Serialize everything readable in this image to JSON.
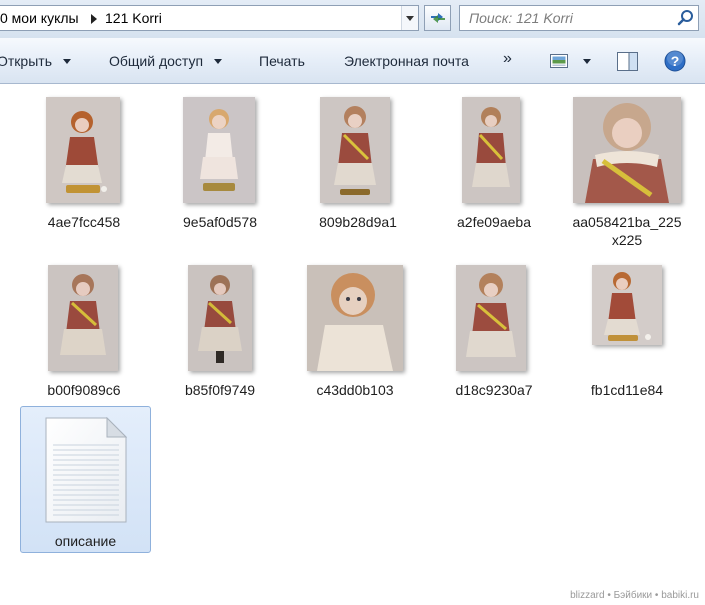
{
  "address": {
    "segments": [
      "0 мои куклы",
      "121 Korri"
    ]
  },
  "search": {
    "placeholder": "Поиск: 121 Korri"
  },
  "toolbar": {
    "open_label": "Открыть",
    "share_label": "Общий доступ",
    "print_label": "Печать",
    "email_label": "Электронная почта",
    "more_label": "»"
  },
  "files": [
    {
      "name": "4ae7fcc458",
      "type": "image"
    },
    {
      "name": "9e5af0d578",
      "type": "image"
    },
    {
      "name": "809b28d9a1",
      "type": "image"
    },
    {
      "name": "a2fe09aeba",
      "type": "image"
    },
    {
      "name_line1": "aa058421ba_225",
      "name_line2": "x225",
      "type": "image"
    },
    {
      "name": "b00f9089c6",
      "type": "image"
    },
    {
      "name": "b85f0f9749",
      "type": "image"
    },
    {
      "name": "c43dd0b103",
      "type": "image"
    },
    {
      "name": "d18c9230a7",
      "type": "image"
    },
    {
      "name": "fb1cd11e84",
      "type": "image"
    },
    {
      "name": "описание",
      "type": "text-document",
      "selected": true
    }
  ],
  "watermark": "blizzard • Бэйбики • babiki.ru",
  "colors": {
    "selection_bg": "#d9e7f8",
    "selection_border": "#8fb1dc",
    "toolbar_bg": "#e6eef8",
    "help_blue": "#2f6fc6"
  }
}
